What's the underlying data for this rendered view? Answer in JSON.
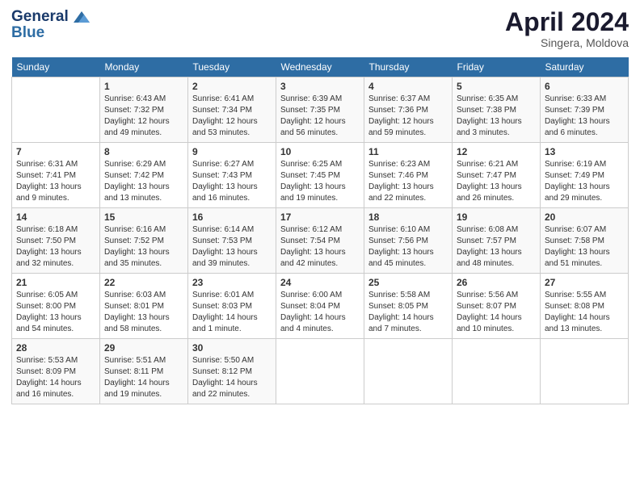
{
  "header": {
    "logo_line1": "General",
    "logo_line2": "Blue",
    "month": "April 2024",
    "location": "Singera, Moldova"
  },
  "weekdays": [
    "Sunday",
    "Monday",
    "Tuesday",
    "Wednesday",
    "Thursday",
    "Friday",
    "Saturday"
  ],
  "weeks": [
    [
      {
        "num": "",
        "sunrise": "",
        "sunset": "",
        "daylight": ""
      },
      {
        "num": "1",
        "sunrise": "Sunrise: 6:43 AM",
        "sunset": "Sunset: 7:32 PM",
        "daylight": "Daylight: 12 hours and 49 minutes."
      },
      {
        "num": "2",
        "sunrise": "Sunrise: 6:41 AM",
        "sunset": "Sunset: 7:34 PM",
        "daylight": "Daylight: 12 hours and 53 minutes."
      },
      {
        "num": "3",
        "sunrise": "Sunrise: 6:39 AM",
        "sunset": "Sunset: 7:35 PM",
        "daylight": "Daylight: 12 hours and 56 minutes."
      },
      {
        "num": "4",
        "sunrise": "Sunrise: 6:37 AM",
        "sunset": "Sunset: 7:36 PM",
        "daylight": "Daylight: 12 hours and 59 minutes."
      },
      {
        "num": "5",
        "sunrise": "Sunrise: 6:35 AM",
        "sunset": "Sunset: 7:38 PM",
        "daylight": "Daylight: 13 hours and 3 minutes."
      },
      {
        "num": "6",
        "sunrise": "Sunrise: 6:33 AM",
        "sunset": "Sunset: 7:39 PM",
        "daylight": "Daylight: 13 hours and 6 minutes."
      }
    ],
    [
      {
        "num": "7",
        "sunrise": "Sunrise: 6:31 AM",
        "sunset": "Sunset: 7:41 PM",
        "daylight": "Daylight: 13 hours and 9 minutes."
      },
      {
        "num": "8",
        "sunrise": "Sunrise: 6:29 AM",
        "sunset": "Sunset: 7:42 PM",
        "daylight": "Daylight: 13 hours and 13 minutes."
      },
      {
        "num": "9",
        "sunrise": "Sunrise: 6:27 AM",
        "sunset": "Sunset: 7:43 PM",
        "daylight": "Daylight: 13 hours and 16 minutes."
      },
      {
        "num": "10",
        "sunrise": "Sunrise: 6:25 AM",
        "sunset": "Sunset: 7:45 PM",
        "daylight": "Daylight: 13 hours and 19 minutes."
      },
      {
        "num": "11",
        "sunrise": "Sunrise: 6:23 AM",
        "sunset": "Sunset: 7:46 PM",
        "daylight": "Daylight: 13 hours and 22 minutes."
      },
      {
        "num": "12",
        "sunrise": "Sunrise: 6:21 AM",
        "sunset": "Sunset: 7:47 PM",
        "daylight": "Daylight: 13 hours and 26 minutes."
      },
      {
        "num": "13",
        "sunrise": "Sunrise: 6:19 AM",
        "sunset": "Sunset: 7:49 PM",
        "daylight": "Daylight: 13 hours and 29 minutes."
      }
    ],
    [
      {
        "num": "14",
        "sunrise": "Sunrise: 6:18 AM",
        "sunset": "Sunset: 7:50 PM",
        "daylight": "Daylight: 13 hours and 32 minutes."
      },
      {
        "num": "15",
        "sunrise": "Sunrise: 6:16 AM",
        "sunset": "Sunset: 7:52 PM",
        "daylight": "Daylight: 13 hours and 35 minutes."
      },
      {
        "num": "16",
        "sunrise": "Sunrise: 6:14 AM",
        "sunset": "Sunset: 7:53 PM",
        "daylight": "Daylight: 13 hours and 39 minutes."
      },
      {
        "num": "17",
        "sunrise": "Sunrise: 6:12 AM",
        "sunset": "Sunset: 7:54 PM",
        "daylight": "Daylight: 13 hours and 42 minutes."
      },
      {
        "num": "18",
        "sunrise": "Sunrise: 6:10 AM",
        "sunset": "Sunset: 7:56 PM",
        "daylight": "Daylight: 13 hours and 45 minutes."
      },
      {
        "num": "19",
        "sunrise": "Sunrise: 6:08 AM",
        "sunset": "Sunset: 7:57 PM",
        "daylight": "Daylight: 13 hours and 48 minutes."
      },
      {
        "num": "20",
        "sunrise": "Sunrise: 6:07 AM",
        "sunset": "Sunset: 7:58 PM",
        "daylight": "Daylight: 13 hours and 51 minutes."
      }
    ],
    [
      {
        "num": "21",
        "sunrise": "Sunrise: 6:05 AM",
        "sunset": "Sunset: 8:00 PM",
        "daylight": "Daylight: 13 hours and 54 minutes."
      },
      {
        "num": "22",
        "sunrise": "Sunrise: 6:03 AM",
        "sunset": "Sunset: 8:01 PM",
        "daylight": "Daylight: 13 hours and 58 minutes."
      },
      {
        "num": "23",
        "sunrise": "Sunrise: 6:01 AM",
        "sunset": "Sunset: 8:03 PM",
        "daylight": "Daylight: 14 hours and 1 minute."
      },
      {
        "num": "24",
        "sunrise": "Sunrise: 6:00 AM",
        "sunset": "Sunset: 8:04 PM",
        "daylight": "Daylight: 14 hours and 4 minutes."
      },
      {
        "num": "25",
        "sunrise": "Sunrise: 5:58 AM",
        "sunset": "Sunset: 8:05 PM",
        "daylight": "Daylight: 14 hours and 7 minutes."
      },
      {
        "num": "26",
        "sunrise": "Sunrise: 5:56 AM",
        "sunset": "Sunset: 8:07 PM",
        "daylight": "Daylight: 14 hours and 10 minutes."
      },
      {
        "num": "27",
        "sunrise": "Sunrise: 5:55 AM",
        "sunset": "Sunset: 8:08 PM",
        "daylight": "Daylight: 14 hours and 13 minutes."
      }
    ],
    [
      {
        "num": "28",
        "sunrise": "Sunrise: 5:53 AM",
        "sunset": "Sunset: 8:09 PM",
        "daylight": "Daylight: 14 hours and 16 minutes."
      },
      {
        "num": "29",
        "sunrise": "Sunrise: 5:51 AM",
        "sunset": "Sunset: 8:11 PM",
        "daylight": "Daylight: 14 hours and 19 minutes."
      },
      {
        "num": "30",
        "sunrise": "Sunrise: 5:50 AM",
        "sunset": "Sunset: 8:12 PM",
        "daylight": "Daylight: 14 hours and 22 minutes."
      },
      {
        "num": "",
        "sunrise": "",
        "sunset": "",
        "daylight": ""
      },
      {
        "num": "",
        "sunrise": "",
        "sunset": "",
        "daylight": ""
      },
      {
        "num": "",
        "sunrise": "",
        "sunset": "",
        "daylight": ""
      },
      {
        "num": "",
        "sunrise": "",
        "sunset": "",
        "daylight": ""
      }
    ]
  ]
}
